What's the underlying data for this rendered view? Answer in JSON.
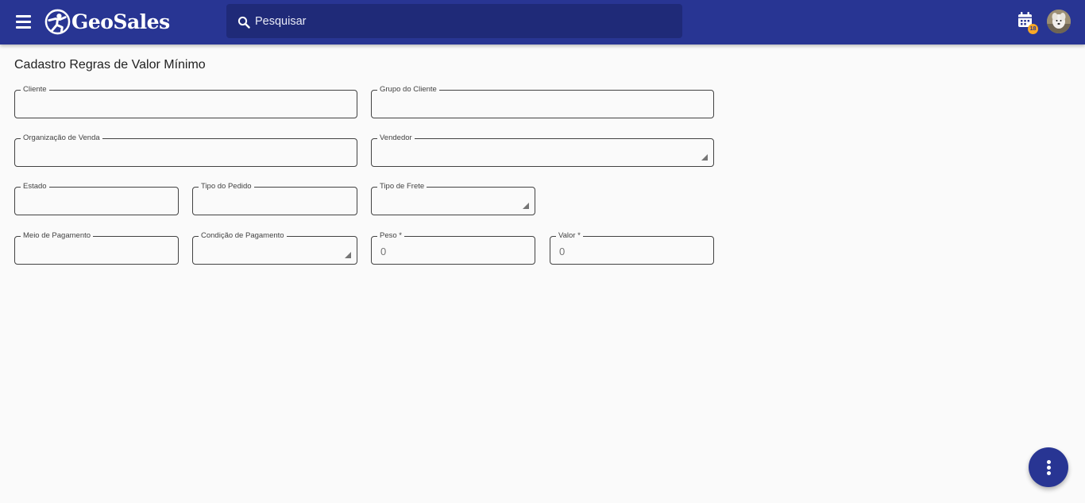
{
  "app": {
    "name": "GeoSales"
  },
  "header": {
    "search_placeholder": "Pesquisar",
    "calendar_badge": "18"
  },
  "page": {
    "title": "Cadastro Regras de Valor Mínimo"
  },
  "form": {
    "cliente": {
      "label": "Cliente",
      "value": ""
    },
    "grupo_cliente": {
      "label": "Grupo do Cliente",
      "value": ""
    },
    "organizacao_venda": {
      "label": "Organização de Venda",
      "value": ""
    },
    "vendedor": {
      "label": "Vendedor",
      "value": ""
    },
    "estado": {
      "label": "Estado",
      "value": ""
    },
    "tipo_pedido": {
      "label": "Tipo do Pedido",
      "value": ""
    },
    "tipo_frete": {
      "label": "Tipo de Frete",
      "value": ""
    },
    "meio_pagamento": {
      "label": "Meio de Pagamento",
      "value": ""
    },
    "condicao_pagamento": {
      "label": "Condição de Pagamento",
      "value": ""
    },
    "peso": {
      "label": "Peso *",
      "value": "0"
    },
    "valor": {
      "label": "Valor *",
      "value": "0"
    }
  },
  "colors": {
    "brand": "#283593",
    "search_bg": "#1f2a78",
    "badge": "#f9a825"
  }
}
